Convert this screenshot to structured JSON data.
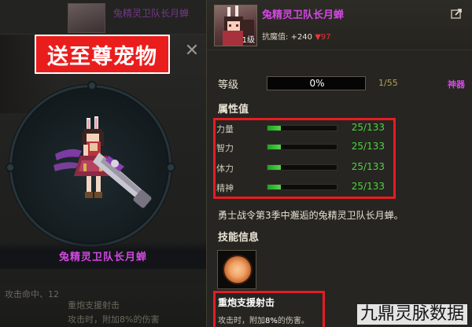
{
  "left_panel": {
    "top_strip_name": "兔精灵卫队长月蝉",
    "promo_banner": "送至尊宠物",
    "close_glyph": "✕",
    "pet_name": "兔精灵卫队长月蝉",
    "ghost_lines": [
      "攻击命中、12",
      "重炮支援射击",
      "攻击时，附加8%的伤害"
    ]
  },
  "header": {
    "pet_name": "兔精灵卫队长月蝉",
    "portrait_level": "1级",
    "resist_label": "抗魔值:",
    "resist_plus": "+240",
    "resist_down": "▼97",
    "share_icon": "share-icon"
  },
  "level": {
    "label": "等级",
    "percent": "0%",
    "progress": 0,
    "count": "1/55",
    "tag": "神器"
  },
  "attributes": {
    "title": "属性值",
    "items": [
      {
        "name": "力量",
        "value": "25/133",
        "ratio": 0.188
      },
      {
        "name": "智力",
        "value": "25/133",
        "ratio": 0.188
      },
      {
        "name": "体力",
        "value": "25/133",
        "ratio": 0.188
      },
      {
        "name": "精神",
        "value": "25/133",
        "ratio": 0.188
      }
    ],
    "highlight_color": "#e61c22"
  },
  "description": "勇士战令第3季中邂逅的兔精灵卫队长月蝉。",
  "skill": {
    "title": "技能信息",
    "name": "重炮支援射击",
    "desc_prefix": "攻击时，附加",
    "desc_pct": "8%",
    "desc_suffix": "的伤害。"
  },
  "watermark": "九鼎灵脉数据",
  "colors": {
    "accent_purple": "#d348e2",
    "stat_green": "#4cd53b",
    "highlight_red": "#e61c22",
    "down_red": "#e8333a",
    "count_gold": "#b7a257"
  }
}
